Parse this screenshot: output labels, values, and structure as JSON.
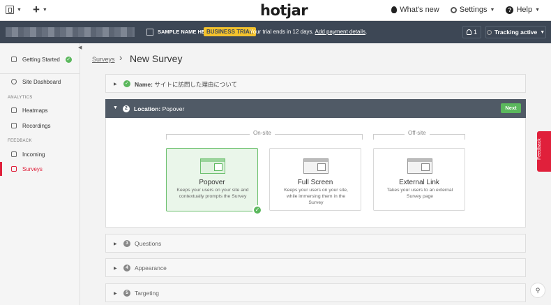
{
  "topbar": {
    "logo": "hotjar",
    "whats_new": "What's new",
    "settings": "Settings",
    "help": "Help"
  },
  "account_bar": {
    "site_name": "SAMPLE NAME HERE",
    "trial_badge": "BUSINESS TRIAL",
    "trial_text": "Your trial ends in 12 days.",
    "trial_link": "Add payment details",
    "trial_suffix": ".",
    "users_count": "1",
    "tracking": "Tracking active"
  },
  "sidebar": {
    "getting_started": "Getting Started",
    "site_dashboard": "Site Dashboard",
    "analytics_heading": "ANALYTICS",
    "heatmaps": "Heatmaps",
    "recordings": "Recordings",
    "feedback_heading": "FEEDBACK",
    "incoming": "Incoming",
    "surveys": "Surveys"
  },
  "breadcrumb": {
    "parent": "Surveys",
    "separator": "›",
    "current": "New Survey"
  },
  "steps": {
    "name": {
      "label": "Name:",
      "value": "サイトに訪問した理由について"
    },
    "location": {
      "number": "2",
      "label": "Location:",
      "value": "Popover",
      "next": "Next"
    },
    "questions": {
      "number": "3",
      "label": "Questions"
    },
    "appearance": {
      "number": "4",
      "label": "Appearance"
    },
    "targeting": {
      "number": "5",
      "label": "Targeting"
    }
  },
  "location_options": {
    "onsite_label": "On-site",
    "offsite_label": "Off-site",
    "popover": {
      "title": "Popover",
      "desc": "Keeps your users on your site and contextually prompts the Survey"
    },
    "fullscreen": {
      "title": "Full Screen",
      "desc": "Keeps your users on your site, while immersing them in the Survey"
    },
    "external": {
      "title": "External Link",
      "desc": "Takes your users to an external Survey page"
    }
  },
  "feedback_tab": "Feedback",
  "colors": {
    "accent": "#e0203b",
    "green": "#5bb85d",
    "dark_bar": "#3d4755",
    "trial_badge": "#f5c32c"
  }
}
